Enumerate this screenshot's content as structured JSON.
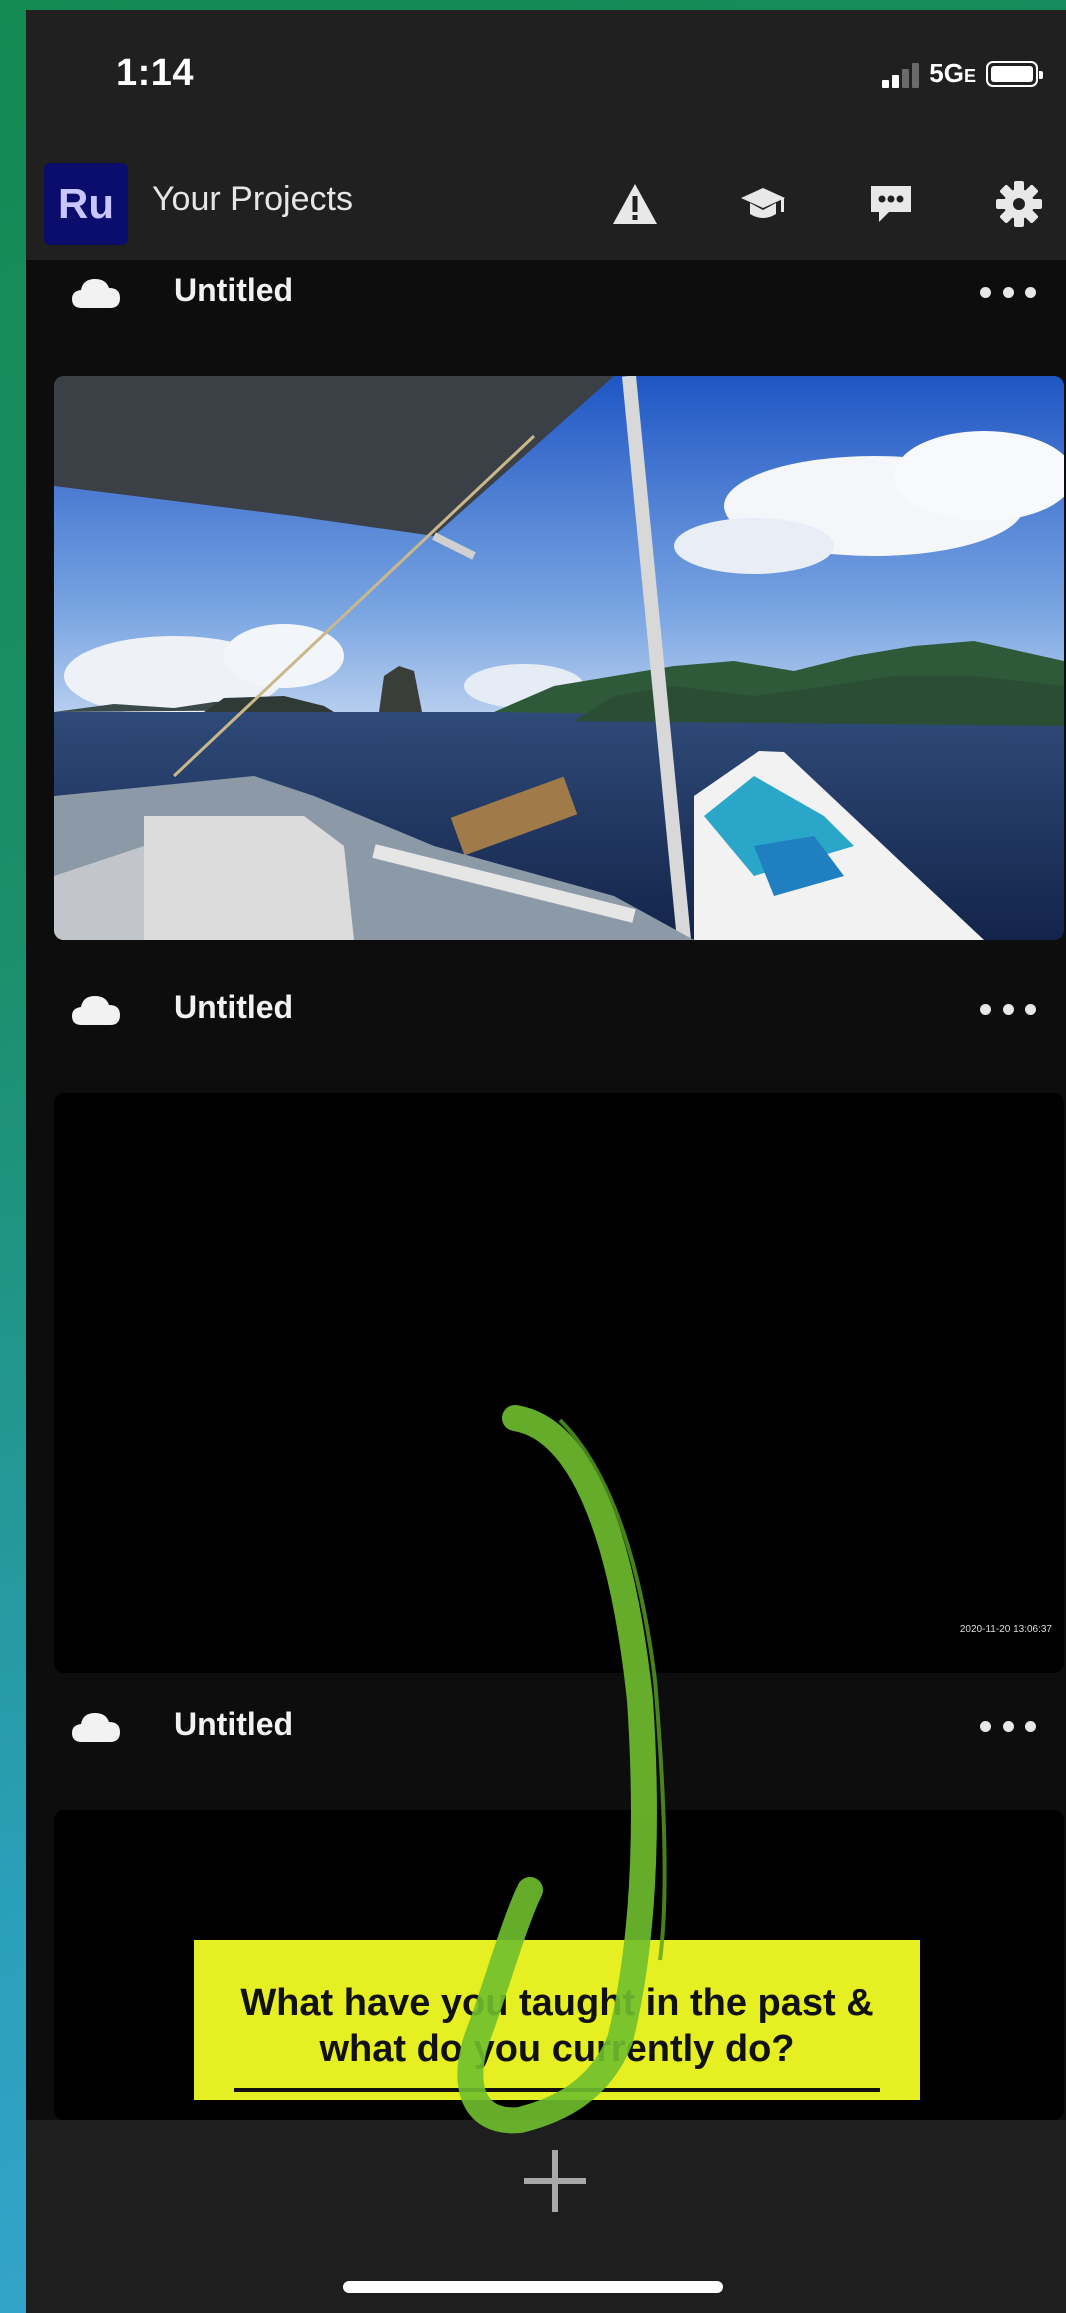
{
  "status_bar": {
    "time": "1:14",
    "network": "5G",
    "network_suffix": "E"
  },
  "header": {
    "logo_text": "Ru",
    "title": "Your Projects",
    "icons": [
      "warning-icon",
      "tutorials-graduation-cap-icon",
      "feedback-chat-icon",
      "settings-gear-icon"
    ]
  },
  "projects": [
    {
      "title": "Untitled",
      "thumbnail": "boat-seascape-image"
    },
    {
      "title": "Untitled",
      "thumbnail": "black-video-frame",
      "timestamp": "2020-11-20 13:06:37"
    },
    {
      "title": "Untitled",
      "thumbnail": "title-card",
      "card_text_line1": "What have you taught in the past &",
      "card_text_line2": "what do you currently do?"
    }
  ],
  "bottom_bar": {
    "add_icon": "plus-icon"
  },
  "colors": {
    "app_bg": "#0d0d0d",
    "header_bg": "#202020",
    "logo_bg": "#0a0d6b",
    "card_yellow": "#e6ef22",
    "annotation_green": "#6fbf2e"
  }
}
